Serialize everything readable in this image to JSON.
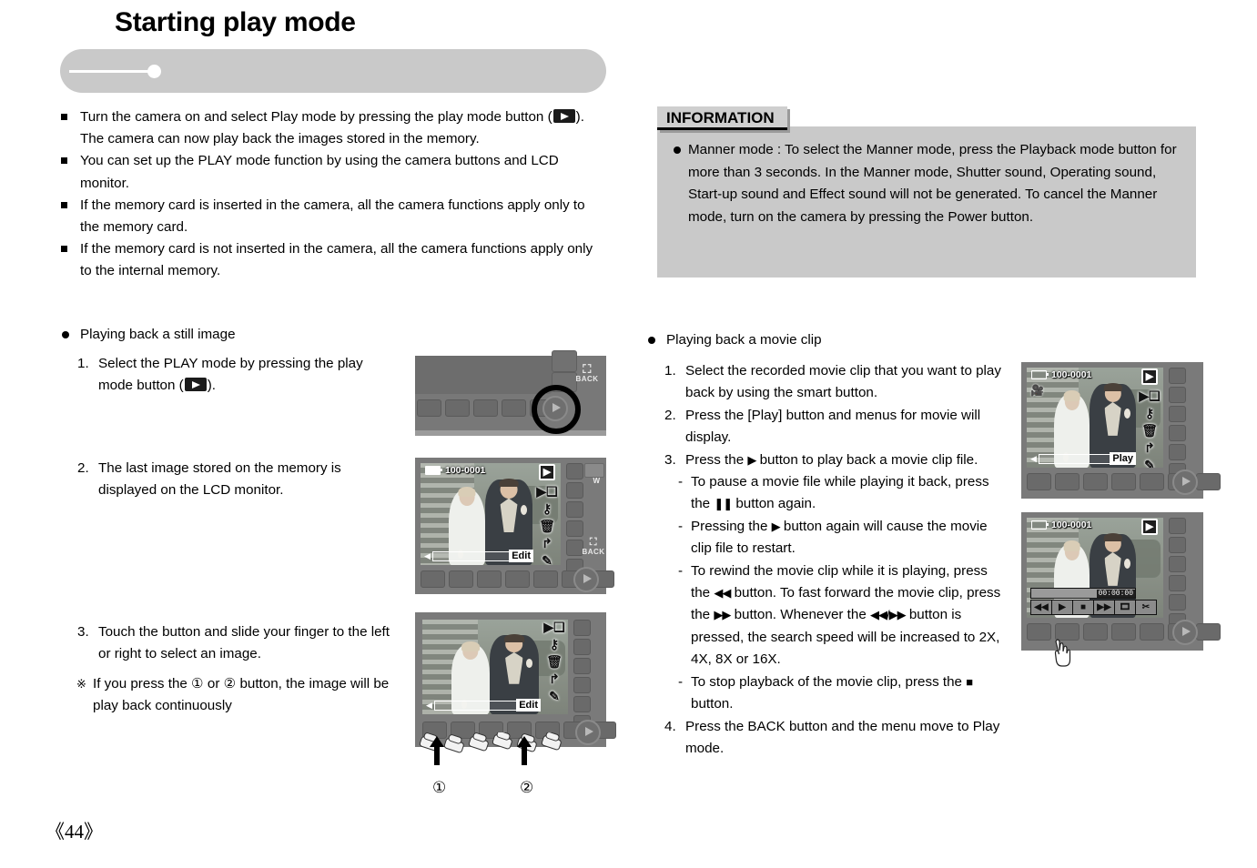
{
  "page": {
    "title": "Starting play mode",
    "page_number": "《44》"
  },
  "intro_bullets": [
    {
      "part1": "Turn the camera on and select Play mode by pressing the play mode button (",
      "icon": "play-button-icon",
      "part2": "). The camera can now play back the images stored in the memory."
    },
    {
      "part1": "You can set up the PLAY mode function by using the camera buttons and LCD monitor.",
      "icon": "",
      "part2": ""
    },
    {
      "part1": "If the memory card is inserted in the camera, all the camera functions apply only to the memory card.",
      "icon": "",
      "part2": ""
    },
    {
      "part1": "If the memory card is not inserted in the camera, all the camera functions apply only to the internal memory.",
      "icon": "",
      "part2": ""
    }
  ],
  "information": {
    "label": "INFORMATION",
    "lead": "Manner mode : ",
    "body": "To select the Manner mode, press the Playback mode button for more than 3 seconds. In the Manner mode, Shutter sound, Operating sound, Start-up sound and Effect sound will not be generated. To cancel the Manner mode, turn on the camera by pressing the Power button."
  },
  "still_section": {
    "heading": "Playing back a still image",
    "steps": [
      {
        "num": "1.",
        "text_a": "Select the PLAY mode by pressing the play mode button (",
        "icon": "play-button-icon",
        "text_b": ")."
      },
      {
        "num": "2.",
        "text_a": "The last image stored on the memory is displayed on the LCD monitor.",
        "icon": "",
        "text_b": ""
      },
      {
        "num": "3.",
        "text_a": "Touch the button and slide your finger to the left or right to select an image.",
        "icon": "",
        "text_b": ""
      }
    ],
    "note_mark": "※",
    "note": "If you press the ①  or ② button, the image will be play back continuously"
  },
  "movie_section": {
    "heading": "Playing back a movie clip",
    "steps": [
      {
        "num": "1.",
        "text": "Select the recorded movie clip that you want to play back by using the smart button."
      },
      {
        "num": "2.",
        "text": "Press the [Play] button and menus for movie will display."
      },
      {
        "num": "3.",
        "text_a": "Press the ",
        "glyph": "▶",
        "text_b": " button to play back a movie clip file."
      }
    ],
    "sub_steps": [
      {
        "dash": "-",
        "text_a": "To pause a movie file while playing it back, press the ",
        "glyph": "❚❚",
        "text_b": " button again."
      },
      {
        "dash": "-",
        "text_a": "Pressing the ",
        "glyph": "▶",
        "text_b": " button again will cause the movie clip file to restart."
      },
      {
        "dash": "-",
        "text_a": "To rewind the movie clip while it is playing, press the ",
        "glyph": "◀◀",
        "text_b": " button. To fast forward the movie clip, press the ",
        "glyph2": "▶▶",
        "text_c": " button. Whenever the ",
        "glyph3": "◀◀/▶▶",
        "text_d": " button is pressed, the search speed will be increased to 2X, 4X, 8X or 16X."
      },
      {
        "dash": "-",
        "text_a": "To stop playback of the movie clip, press the ",
        "glyph": "■",
        "text_b": " button."
      }
    ],
    "final_step": {
      "num": "4.",
      "text": "Press the BACK button and the menu move to Play mode."
    }
  },
  "figures": {
    "fig1": {
      "name": "camera-back-play-button",
      "back_label": "BACK"
    },
    "fig2": {
      "name": "lcd-still-image",
      "file_number": "100-0001",
      "edit_label": "Edit",
      "back_label": "BACK",
      "zoom_label": "W",
      "icons": [
        "play-mode-icon",
        "slideshow-icon",
        "protect-icon",
        "delete-icon",
        "rotate-icon",
        "resize-icon"
      ]
    },
    "fig3": {
      "name": "lcd-touch-slide",
      "edit_label": "Edit",
      "callout_1": "①",
      "callout_2": "②",
      "icons": [
        "slideshow-icon",
        "protect-icon",
        "delete-icon",
        "rotate-icon",
        "resize-icon"
      ]
    },
    "fig4": {
      "name": "lcd-movie-menu",
      "file_number": "100-0001",
      "play_label": "Play",
      "movie_icon": "movie-camera-icon",
      "icons": [
        "play-mode-icon",
        "slideshow-icon",
        "protect-icon",
        "delete-icon",
        "rotate-icon",
        "resize-icon"
      ]
    },
    "fig5": {
      "name": "lcd-movie-playback",
      "file_number": "100-0001",
      "time": "00:00:00",
      "controls": [
        "◀◀",
        "▶",
        "■",
        "▶▶",
        "capture-icon",
        "trim-icon"
      ]
    }
  }
}
